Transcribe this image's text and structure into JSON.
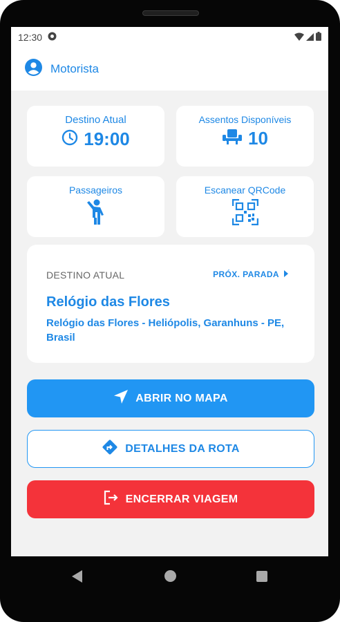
{
  "status_bar": {
    "time": "12:30"
  },
  "header": {
    "title": "Motorista"
  },
  "cards": {
    "current_destination": {
      "label": "Destino Atual",
      "value": "19:00",
      "icon": "clock-icon"
    },
    "available_seats": {
      "label": "Assentos Disponíveis",
      "value": "10",
      "icon": "seat-icon"
    },
    "passengers": {
      "label": "Passageiros",
      "icon": "person-icon"
    },
    "scan_qr": {
      "label": "Escanear QRCode",
      "icon": "qr-code-icon"
    }
  },
  "destination": {
    "section_label": "DESTINO ATUAL",
    "next_stop_label": "PRÓX. PARADA",
    "name": "Relógio das Flores",
    "address": "Relógio das Flores - Heliópolis, Garanhuns - PE, Brasil"
  },
  "buttons": {
    "open_map": "ABRIR NO MAPA",
    "route_details": "DETALHES DA ROTA",
    "end_trip": "ENCERRAR VIAGEM"
  },
  "colors": {
    "primary": "#1e88e5",
    "danger": "#f4333a",
    "background": "#f2f2f2"
  }
}
